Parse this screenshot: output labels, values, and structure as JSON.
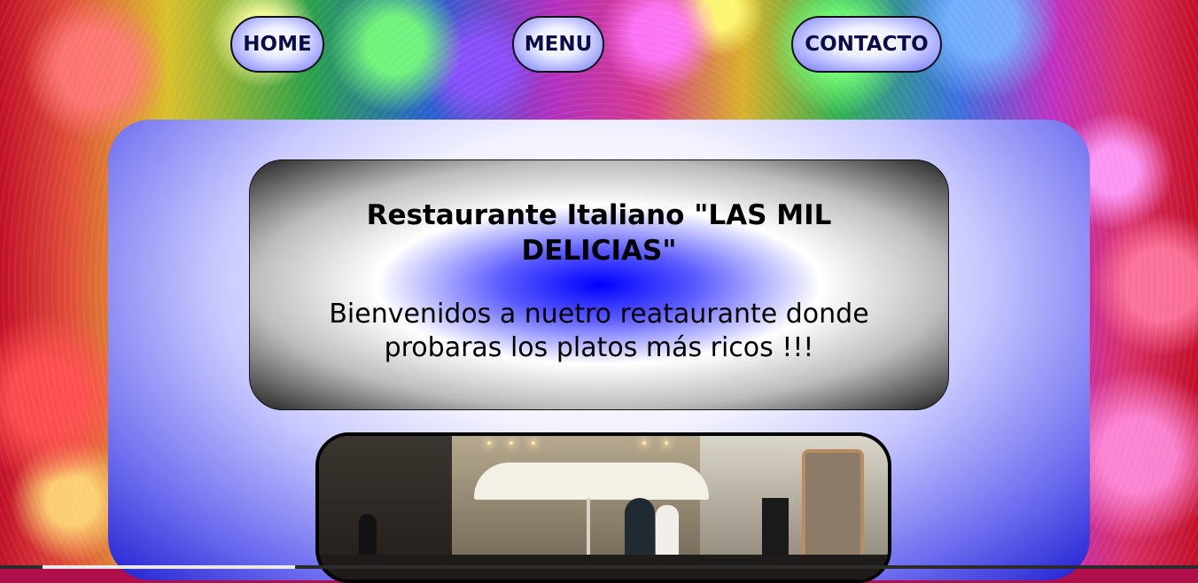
{
  "nav": {
    "home_label": "HOME",
    "menu_label": "MENU",
    "contact_label": "CONTACTO"
  },
  "hero": {
    "title": "Restaurante Italiano \"LAS MIL DELICIAS\"",
    "subtitle": "Bienvenidos a nuetro reataurante donde probaras los platos más ricos !!!"
  },
  "colors": {
    "panel_blue": "#1f1fd0",
    "nav_text": "#0b0b4a",
    "hero_center_blue": "#0000ff"
  },
  "photo": {
    "subject": "restaurant-street-photo"
  }
}
